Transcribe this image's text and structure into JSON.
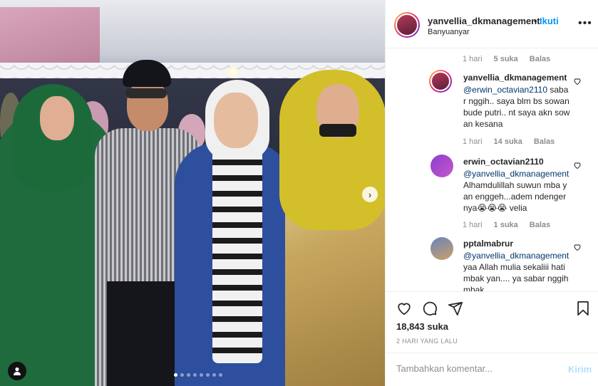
{
  "post": {
    "username": "yanvellia_dkmanagement",
    "separator": "•",
    "follow_label": "Ikuti",
    "location": "Banyuanyar",
    "photo_count": 8,
    "active_photo_index": 0
  },
  "comments": [
    {
      "meta": {
        "time": "1 hari",
        "likes": "5 suka",
        "reply": "Balas"
      }
    },
    {
      "username": "yanvellia_dkmanagement",
      "mention": "@erwin_octavian2110",
      "text": "sabar nggih.. saya blm bs sowan bude putri.. nt saya akn sowan kesana",
      "meta": {
        "time": "1 hari",
        "likes": "14 suka",
        "reply": "Balas"
      }
    },
    {
      "username": "erwin_octavian2110",
      "mention": "@yanvellia_dkmanagement",
      "text": "Alhamdulillah suwun mba yan enggeh...adem ndengernya😭😭😭 velia",
      "meta": {
        "time": "1 hari",
        "likes": "1 suka",
        "reply": "Balas"
      }
    },
    {
      "username": "pptalmabrur",
      "mention": "@yanvellia_dkmanagement",
      "text": "yaa Allah mulia sekaliii hati mbak yan.... ya sabar nggih mbak"
    }
  ],
  "actions": {
    "likes_count": "18,843 suka",
    "time_ago": "2 HARI YANG LALU"
  },
  "compose": {
    "placeholder": "Tambahkan komentar...",
    "post_label": "Kirim"
  },
  "icons": {
    "more": "more-options-icon",
    "heart": "heart-icon",
    "comment": "comment-icon",
    "share": "share-icon",
    "save": "bookmark-icon",
    "next": "chevron-right-icon",
    "tag": "user-tag-icon"
  },
  "colors": {
    "accent_blue": "#0095f6",
    "post_disabled": "#b2dffc",
    "muted_text": "#8e8e8e",
    "mention": "#00376b"
  }
}
